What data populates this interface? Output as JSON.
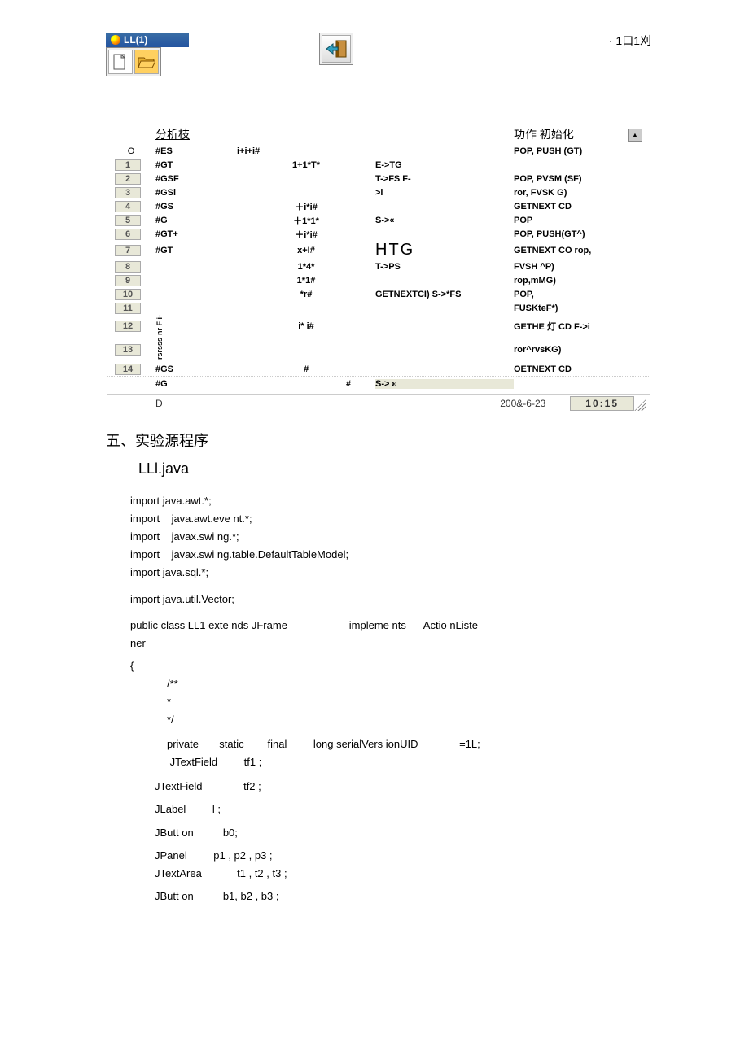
{
  "header": {
    "app_title": "LL(1)",
    "page_num": "· 1口1刈"
  },
  "grid": {
    "headers": {
      "stack": "分析枝",
      "action": "功作  初始化"
    },
    "top_row": {
      "num": "O",
      "stack": "#ES",
      "input": "i+i+i#",
      "prod": "",
      "action": "POP, PUSH (GT)"
    },
    "rows": [
      {
        "num": "1",
        "stack": "#GT",
        "input": "1+1*T*",
        "prod": "E->TG",
        "action": ""
      },
      {
        "num": "2",
        "stack": "#GSF",
        "input": "",
        "prod": "T->FS F-",
        "action": "POP, PVSM (SF)"
      },
      {
        "num": "3",
        "stack": "#GSi",
        "input": "",
        "prod": ">i",
        "action": "ror, FVSK G)"
      },
      {
        "num": "4",
        "stack": "#GS",
        "input": "＋i*i#",
        "prod": "",
        "action": "GETNEXT CD"
      },
      {
        "num": "5",
        "stack": "#G",
        "input": "＋1*1*",
        "prod": "S->«",
        "action": "POP"
      },
      {
        "num": "6",
        "stack": "#GT+",
        "input": "＋i*i#",
        "prod": "",
        "action": "POP, PUSH(GT^)"
      },
      {
        "num": "7",
        "stack": "#GT",
        "input": "x+I#",
        "prod": "HTG",
        "action": "GETNEXT CO rop,",
        "big": true
      },
      {
        "num": "8",
        "stack": "",
        "input": "1*4*",
        "prod": "T->PS",
        "action": "FVSH ^P)"
      },
      {
        "num": "9",
        "stack": "",
        "input": "1*1#",
        "prod": "",
        "action": "rop,mMG)"
      },
      {
        "num": "10",
        "stack": "",
        "input": "*r#",
        "prod": "GETNEXTCI) S->*FS",
        "action": "POP,"
      },
      {
        "num": "11",
        "stack": "",
        "input": "",
        "prod": "",
        "action": "FUSKteF*)"
      },
      {
        "num": "12",
        "stack": "",
        "input": "i* i#",
        "prod": "",
        "action": "GETHE 灯 CD F->i",
        "rot": "nr F i-"
      },
      {
        "num": "13",
        "stack": "",
        "input": "",
        "prod": "",
        "action": "ror^rvsKG)",
        "rot": "rsrsss"
      },
      {
        "num": "14",
        "stack": "#GS",
        "input": "#",
        "prod": "",
        "action": "OETNEXT CD"
      }
    ],
    "bottom_row": {
      "stack": "#G",
      "input": "#",
      "prod": "S-> ε"
    },
    "status": {
      "D": "D",
      "date": "200&-6-23",
      "time": "10:15"
    }
  },
  "section": {
    "title": "五、实验源程序",
    "subtitle": "LLl.java"
  },
  "code": {
    "l1": "import java.awt.*;",
    "l2": "import    java.awt.eve nt.*;",
    "l3": "import    javax.swi ng.*;",
    "l4": "import    javax.swi ng.table.DefaultTableModel;",
    "l5": "import java.sql.*;",
    "l6": "import java.util.Vector;",
    "l7": "public class LL1 exte nds JFrame                     impleme nts      Actio nListe",
    "l7b": "ner",
    "l8": "{",
    "l9": "/**",
    "l10": "*",
    "l11": "*/",
    "l12": "private       static        final         long serialVers ionUID              =1L;",
    "l12b": " JTextField         tf1 ;",
    "l13": "JTextField              tf2 ;",
    "l14": "JLabel         l ;",
    "l15": "JButt on          b0;",
    "l16": "JPanel         p1 , p2 , p3 ;",
    "l16b": "JTextArea            t1 , t2 , t3 ;",
    "l17": "JButt on          b1, b2 , b3 ;"
  }
}
